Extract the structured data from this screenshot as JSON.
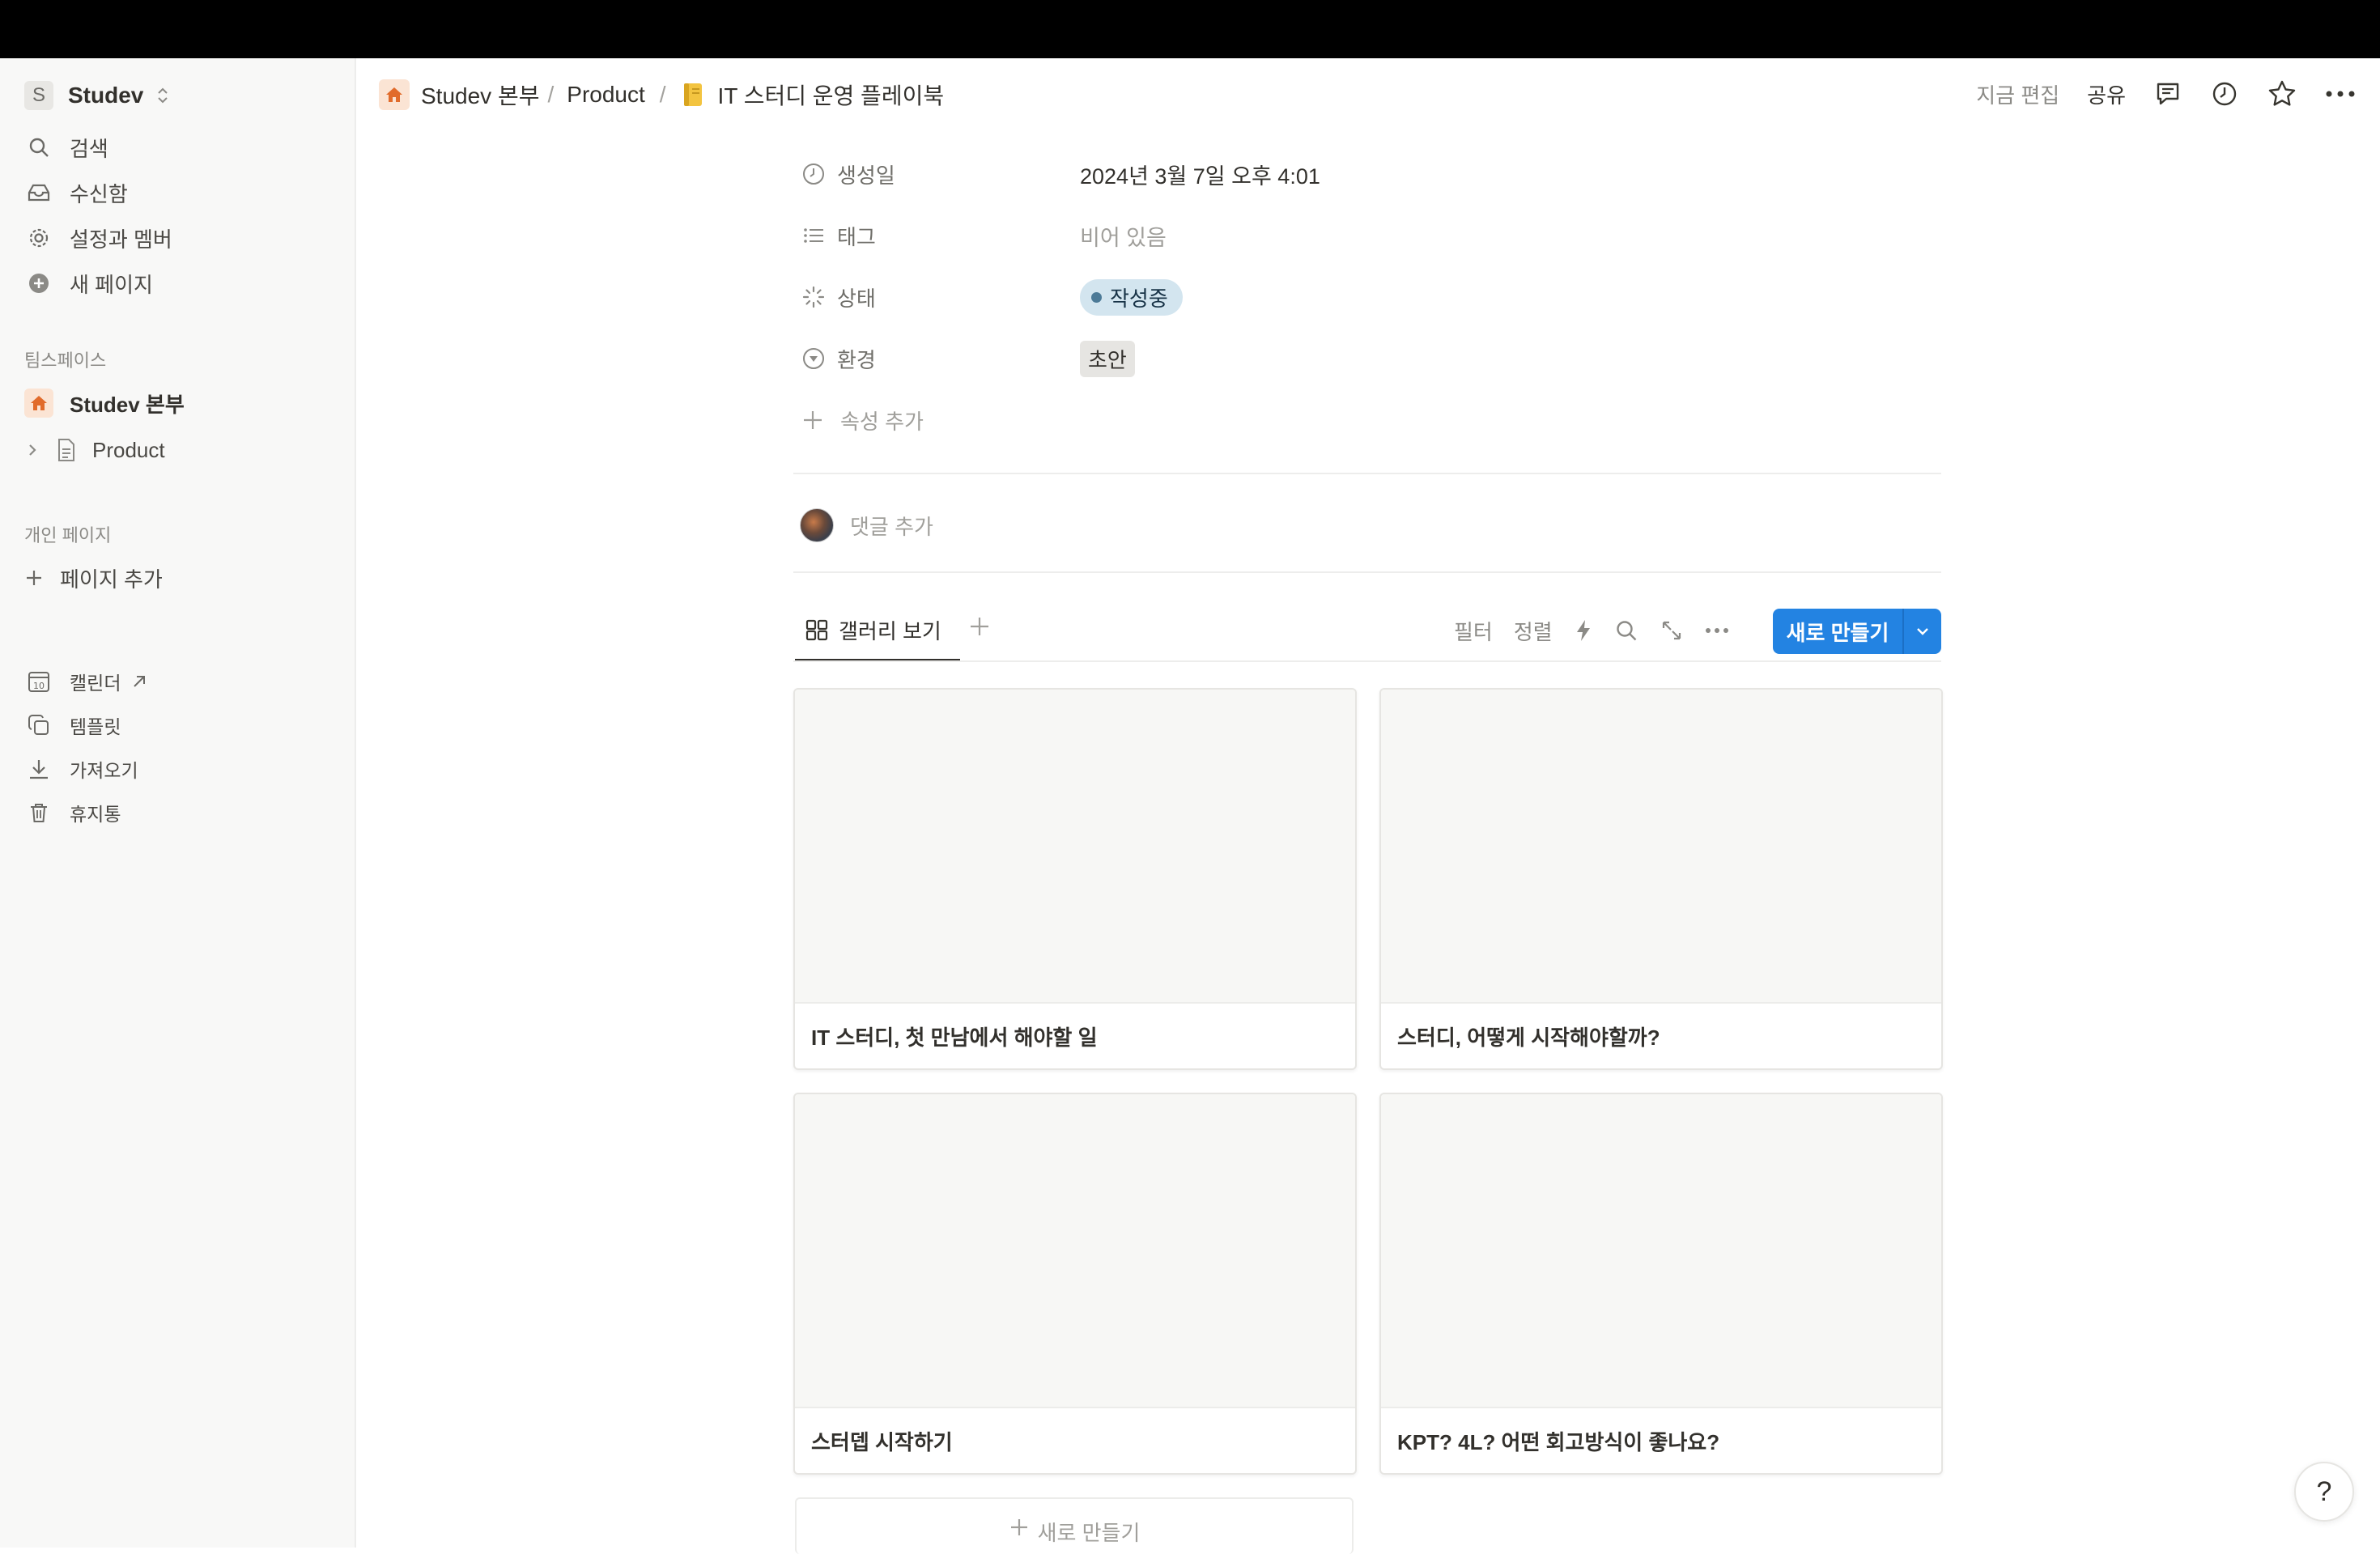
{
  "workspace": {
    "initial": "S",
    "name": "Studev"
  },
  "sidebar": {
    "top_items": [
      {
        "label": "검색",
        "icon": "search-icon"
      },
      {
        "label": "수신함",
        "icon": "inbox-icon"
      },
      {
        "label": "설정과 멤버",
        "icon": "gear-icon"
      },
      {
        "label": "새 페이지",
        "icon": "plus-circle-icon"
      }
    ],
    "teamspace_heading": "팀스페이스",
    "teamspace_items": [
      {
        "label": "Studev 본부",
        "icon": "home-icon"
      },
      {
        "label": "Product",
        "icon": "page-icon"
      }
    ],
    "private_heading": "개인 페이지",
    "add_page_label": "페이지 추가",
    "bottom_items": [
      {
        "label": "캘린더",
        "icon": "calendar-icon"
      },
      {
        "label": "템플릿",
        "icon": "template-icon"
      },
      {
        "label": "가져오기",
        "icon": "download-icon"
      },
      {
        "label": "휴지통",
        "icon": "trash-icon"
      }
    ]
  },
  "breadcrumb": [
    {
      "label": "Studev 본부",
      "icon": "home-icon"
    },
    {
      "label": "Product"
    },
    {
      "label": "IT 스터디 운영 플레이북",
      "icon": "notebook-icon"
    }
  ],
  "header": {
    "edited": "지금 편집",
    "share": "공유"
  },
  "properties": [
    {
      "label": "생성일",
      "value": "2024년 3월 7일 오후 4:01",
      "icon": "clock-icon"
    },
    {
      "label": "태그",
      "value": "비어 있음",
      "icon": "list-icon"
    },
    {
      "label": "상태",
      "value": "작성중",
      "icon": "status-icon"
    },
    {
      "label": "환경",
      "value": "초안",
      "icon": "select-icon"
    }
  ],
  "add_property": "속성 추가",
  "comment_placeholder": "댓글 추가",
  "view": {
    "tab_label": "갤러리 보기",
    "toolbar": {
      "filter": "필터",
      "sort": "정렬"
    },
    "new_button": "새로 만들기"
  },
  "gallery": {
    "cards": [
      {
        "title": "IT 스터디, 첫 만남에서 해야할 일"
      },
      {
        "title": "스터디, 어떻게 시작해야할까?"
      },
      {
        "title": "스터뎁 시작하기"
      },
      {
        "title": "KPT? 4L? 어떤 회고방식이 좋나요?"
      }
    ],
    "new_label": "새로 만들기"
  },
  "help_label": "?",
  "colors": {
    "accent": "#2383e2",
    "status_bg": "#d3e5ef",
    "home_icon": "#e16b2b"
  }
}
